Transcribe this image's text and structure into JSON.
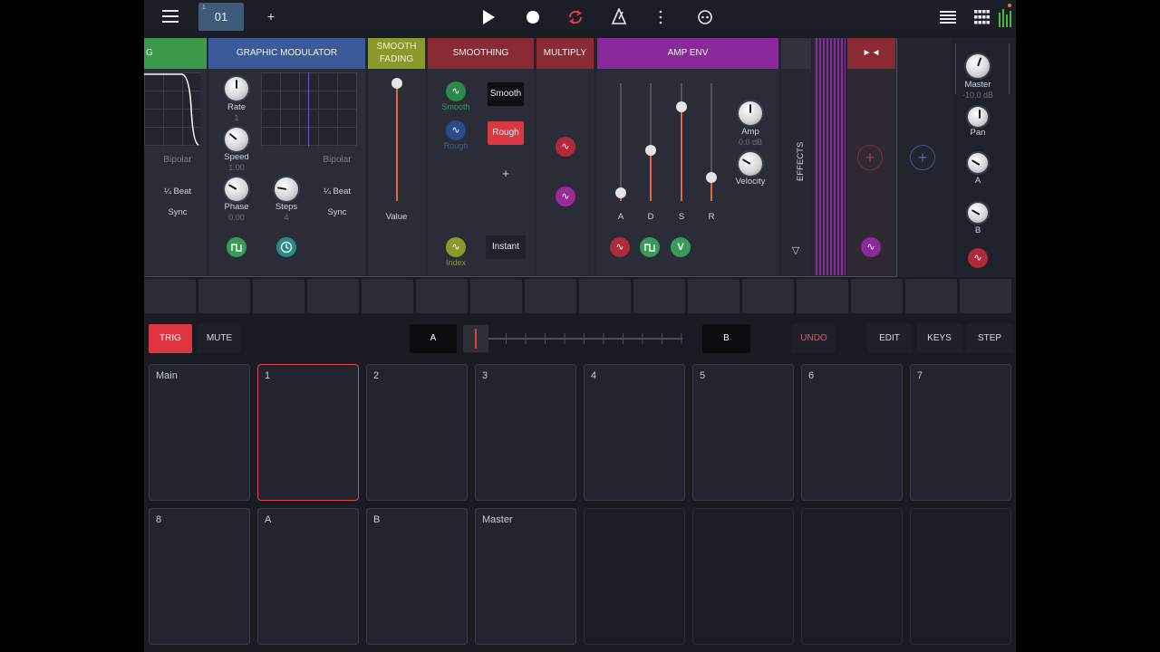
{
  "topbar": {
    "pattern": "01",
    "pattern_sup": "1",
    "add": "+",
    "icons": [
      "menu-icon",
      "play-icon",
      "record-icon",
      "loop-icon",
      "metronome-icon",
      "more-icon",
      "link-icon",
      "list-icon",
      "grid-icon",
      "meter-icon"
    ]
  },
  "rack": {
    "partial": {
      "title": "G",
      "bipolar": "Bipolar",
      "beat": "¼ Beat",
      "sync": "Sync"
    },
    "graphic_mod": {
      "title": "GRAPHIC MODULATOR",
      "rate": "Rate",
      "rate_val": "1",
      "speed": "Speed",
      "speed_val": "1.00",
      "phase": "Phase",
      "phase_val": "0.00",
      "steps": "Steps",
      "steps_val": "4",
      "bipolar": "Bipolar",
      "beat": "¼ Beat",
      "sync": "Sync"
    },
    "smooth_fading": {
      "title_1": "SMOOTH",
      "title_2": "FADING",
      "value": "Value"
    },
    "smoothing": {
      "title": "SMOOTHING",
      "smooth_sub": "Smooth",
      "rough_sub": "Rough",
      "smooth_btn": "Smooth",
      "rough_btn": "Rough",
      "plus": "+",
      "index": "Index",
      "instant": "Instant"
    },
    "multiply": {
      "title": "MULTIPLY"
    },
    "amp_env": {
      "title": "AMP ENV",
      "a": "A",
      "d": "D",
      "s": "S",
      "r": "R",
      "amp": "Amp",
      "amp_val": "0.0 dB",
      "velocity": "Velocity",
      "v": "V"
    },
    "effects": {
      "title": "EFFECTS",
      "arrow": "▽"
    },
    "send": {
      "title": "►◄"
    },
    "master": {
      "master": "Master",
      "master_val": "-10.0 dB",
      "pan": "Pan",
      "a": "A",
      "b": "B"
    }
  },
  "controls": {
    "trig": "TRIG",
    "mute": "MUTE",
    "a": "A",
    "b": "B",
    "undo": "UNDO",
    "edit": "EDIT",
    "keys": "KEYS",
    "step": "STEP"
  },
  "pads": [
    {
      "label": "Main"
    },
    {
      "label": "1"
    },
    {
      "label": "2"
    },
    {
      "label": "3"
    },
    {
      "label": "4"
    },
    {
      "label": "5"
    },
    {
      "label": "6"
    },
    {
      "label": "7"
    },
    {
      "label": "8"
    },
    {
      "label": "A"
    },
    {
      "label": "B"
    },
    {
      "label": "Master"
    },
    {
      "label": ""
    },
    {
      "label": ""
    },
    {
      "label": ""
    },
    {
      "label": ""
    }
  ],
  "selected_pad": "1",
  "colors": {
    "trig": "#e0353f",
    "graphic_mod_header": "#3a5a9a",
    "smooth_fading_header": "#8a9a2a",
    "smoothing_header": "#8a2a35",
    "amp_env_header": "#8a2a9a",
    "partial_header": "#3a9a4a",
    "slider_fill": "#e8643a"
  }
}
